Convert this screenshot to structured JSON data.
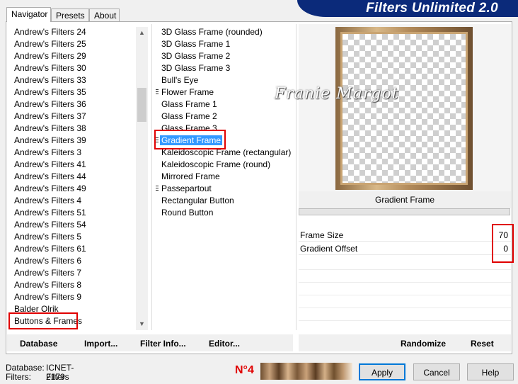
{
  "tabs": [
    "Navigator",
    "Presets",
    "About"
  ],
  "app_title": "Filters Unlimited 2.0",
  "categories": [
    "Andrew's Filters 24",
    "Andrew's Filters 25",
    "Andrew's Filters 29",
    "Andrew's Filters 30",
    "Andrew's Filters 33",
    "Andrew's Filters 35",
    "Andrew's Filters 36",
    "Andrew's Filters 37",
    "Andrew's Filters 38",
    "Andrew's Filters 39",
    "Andrew's Filters 3",
    "Andrew's Filters 41",
    "Andrew's Filters 44",
    "Andrew's Filters 49",
    "Andrew's Filters 4",
    "Andrew's Filters 51",
    "Andrew's Filters 54",
    "Andrew's Filters 5",
    "Andrew's Filters 61",
    "Andrew's Filters 6",
    "Andrew's Filters 7",
    "Andrew's Filters 8",
    "Andrew's Filters 9",
    "Balder Olrik",
    "Buttons & Frames"
  ],
  "filters": [
    {
      "label": "3D Glass Frame (rounded)",
      "grip": false
    },
    {
      "label": "3D Glass Frame 1",
      "grip": false
    },
    {
      "label": "3D Glass Frame 2",
      "grip": false
    },
    {
      "label": "3D Glass Frame 3",
      "grip": false
    },
    {
      "label": "Bull's Eye",
      "grip": false
    },
    {
      "label": "Flower Frame",
      "grip": true
    },
    {
      "label": "Glass Frame 1",
      "grip": false
    },
    {
      "label": "Glass Frame 2",
      "grip": false
    },
    {
      "label": "Glass Frame 3",
      "grip": false
    },
    {
      "label": "Gradient Frame",
      "grip": true,
      "selected": true
    },
    {
      "label": "Kaleidoscopic Frame (rectangular)",
      "grip": false
    },
    {
      "label": "Kaleidoscopic Frame (round)",
      "grip": false
    },
    {
      "label": "Mirrored Frame",
      "grip": false
    },
    {
      "label": "Passepartout",
      "grip": true
    },
    {
      "label": "Rectangular Button",
      "grip": false
    },
    {
      "label": "Round Button",
      "grip": false
    }
  ],
  "watermark": "Franie Margot",
  "preview_filter_name": "Gradient Frame",
  "params": [
    {
      "label": "Frame Size",
      "value": "70"
    },
    {
      "label": "Gradient Offset",
      "value": "0"
    }
  ],
  "toolbar": {
    "database": "Database",
    "import": "Import...",
    "filter_info": "Filter Info...",
    "editor": "Editor...",
    "randomize": "Randomize",
    "reset": "Reset"
  },
  "footer": {
    "database_label": "Database:",
    "database_value": "ICNET-Filters",
    "filters_label": "Filters:",
    "filters_value": "2179",
    "step_label": "N°4",
    "apply": "Apply",
    "cancel": "Cancel",
    "help": "Help"
  },
  "colors": {
    "highlight": "#e00000",
    "selection": "#3399ff",
    "banner": "#0b2a7a"
  }
}
